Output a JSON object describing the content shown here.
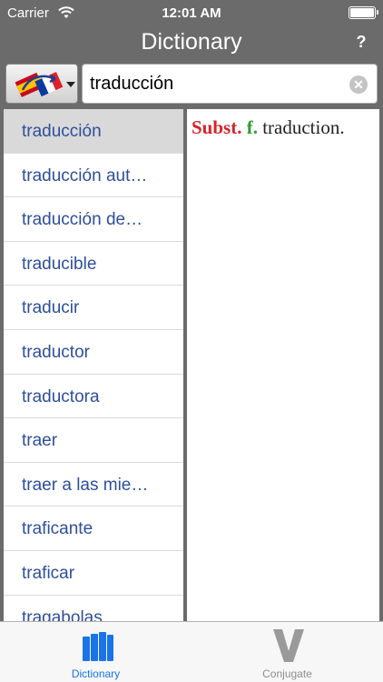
{
  "status_bar": {
    "carrier": "Carrier",
    "time": "12:01 AM"
  },
  "nav": {
    "title": "Dictionary",
    "help_label": "?"
  },
  "search": {
    "value": "traducción",
    "language_icon": "spanish-french-flags-icon",
    "clear_icon": "clear-icon"
  },
  "word_list": [
    {
      "label": "traducción",
      "selected": true
    },
    {
      "label": "traducción aut…"
    },
    {
      "label": "traducción de…"
    },
    {
      "label": "traducible"
    },
    {
      "label": "traducir"
    },
    {
      "label": "traductor"
    },
    {
      "label": "traductora"
    },
    {
      "label": "traer"
    },
    {
      "label": "traer a las mie…"
    },
    {
      "label": "traficante"
    },
    {
      "label": "traficar"
    },
    {
      "label": "tragabolas"
    }
  ],
  "definition": {
    "pos_subst": "Subst.",
    "pos_gender": "f.",
    "translation": "traduction."
  },
  "colors": {
    "accent": "#1a74e8",
    "list_text": "#2e4f9c",
    "subst": "#d3242a",
    "gender": "#2e9c2e",
    "chrome": "#6b6b6b"
  },
  "tabs": [
    {
      "label": "Dictionary",
      "icon": "books-icon",
      "active": true
    },
    {
      "label": "Conjugate",
      "icon": "v-icon",
      "active": false
    }
  ]
}
